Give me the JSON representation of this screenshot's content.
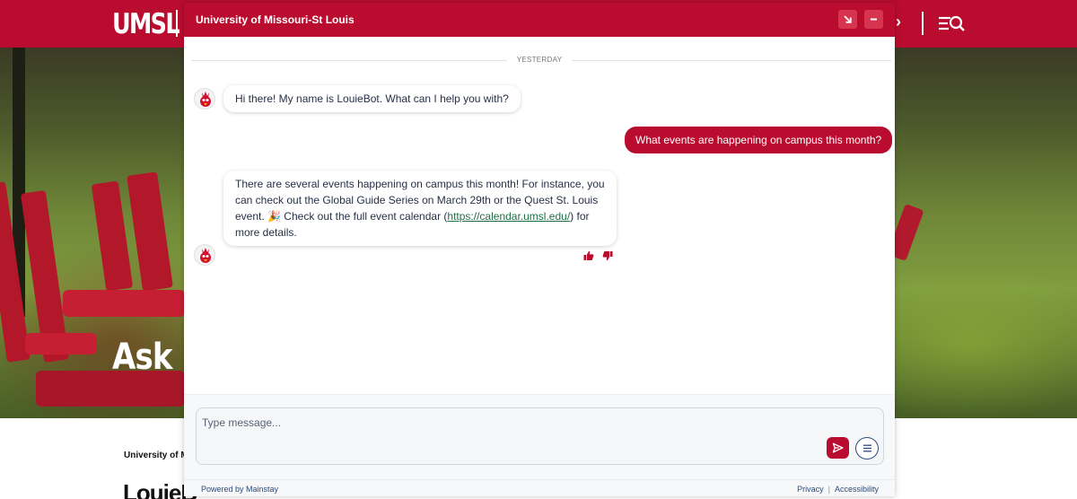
{
  "site": {
    "logo": "UMSL",
    "hero_title": "Ask",
    "below_subtitle": "University of Mi",
    "below_title": "LouieB"
  },
  "chat": {
    "title": "University of Missouri-St Louis",
    "day_separator": "YESTERDAY",
    "messages": [
      {
        "from": "bot",
        "text": "Hi there! My name is LouieBot. What can I help you with?"
      },
      {
        "from": "user",
        "text": "What events are happening on campus this month?"
      },
      {
        "from": "bot",
        "text_before": "There are several events happening on campus this month! For instance, you can check out the Global Guide Series on March 29th or the Quest St. Louis event. 🎉  Check out the full event calendar (",
        "link": "https://calendar.umsl.edu/",
        "text_after": ") for more details."
      }
    ],
    "composer_placeholder": "Type message...",
    "footer_powered": "Powered by Mainstay",
    "footer_privacy": "Privacy",
    "footer_accessibility": "Accessibility"
  },
  "icons": {
    "expand": "arrow-down-right-icon",
    "minimize": "minus-icon",
    "send": "send-icon",
    "menu": "menu-lines-icon",
    "thumbs_up": "thumbs-up-icon",
    "thumbs_down": "thumbs-down-icon",
    "site_menu": "menu-search-icon"
  },
  "colors": {
    "brand_red": "#ba0c2f",
    "link_green": "#1f6f46",
    "text_dark": "#273046",
    "footer_blue": "#2c4a7a"
  }
}
